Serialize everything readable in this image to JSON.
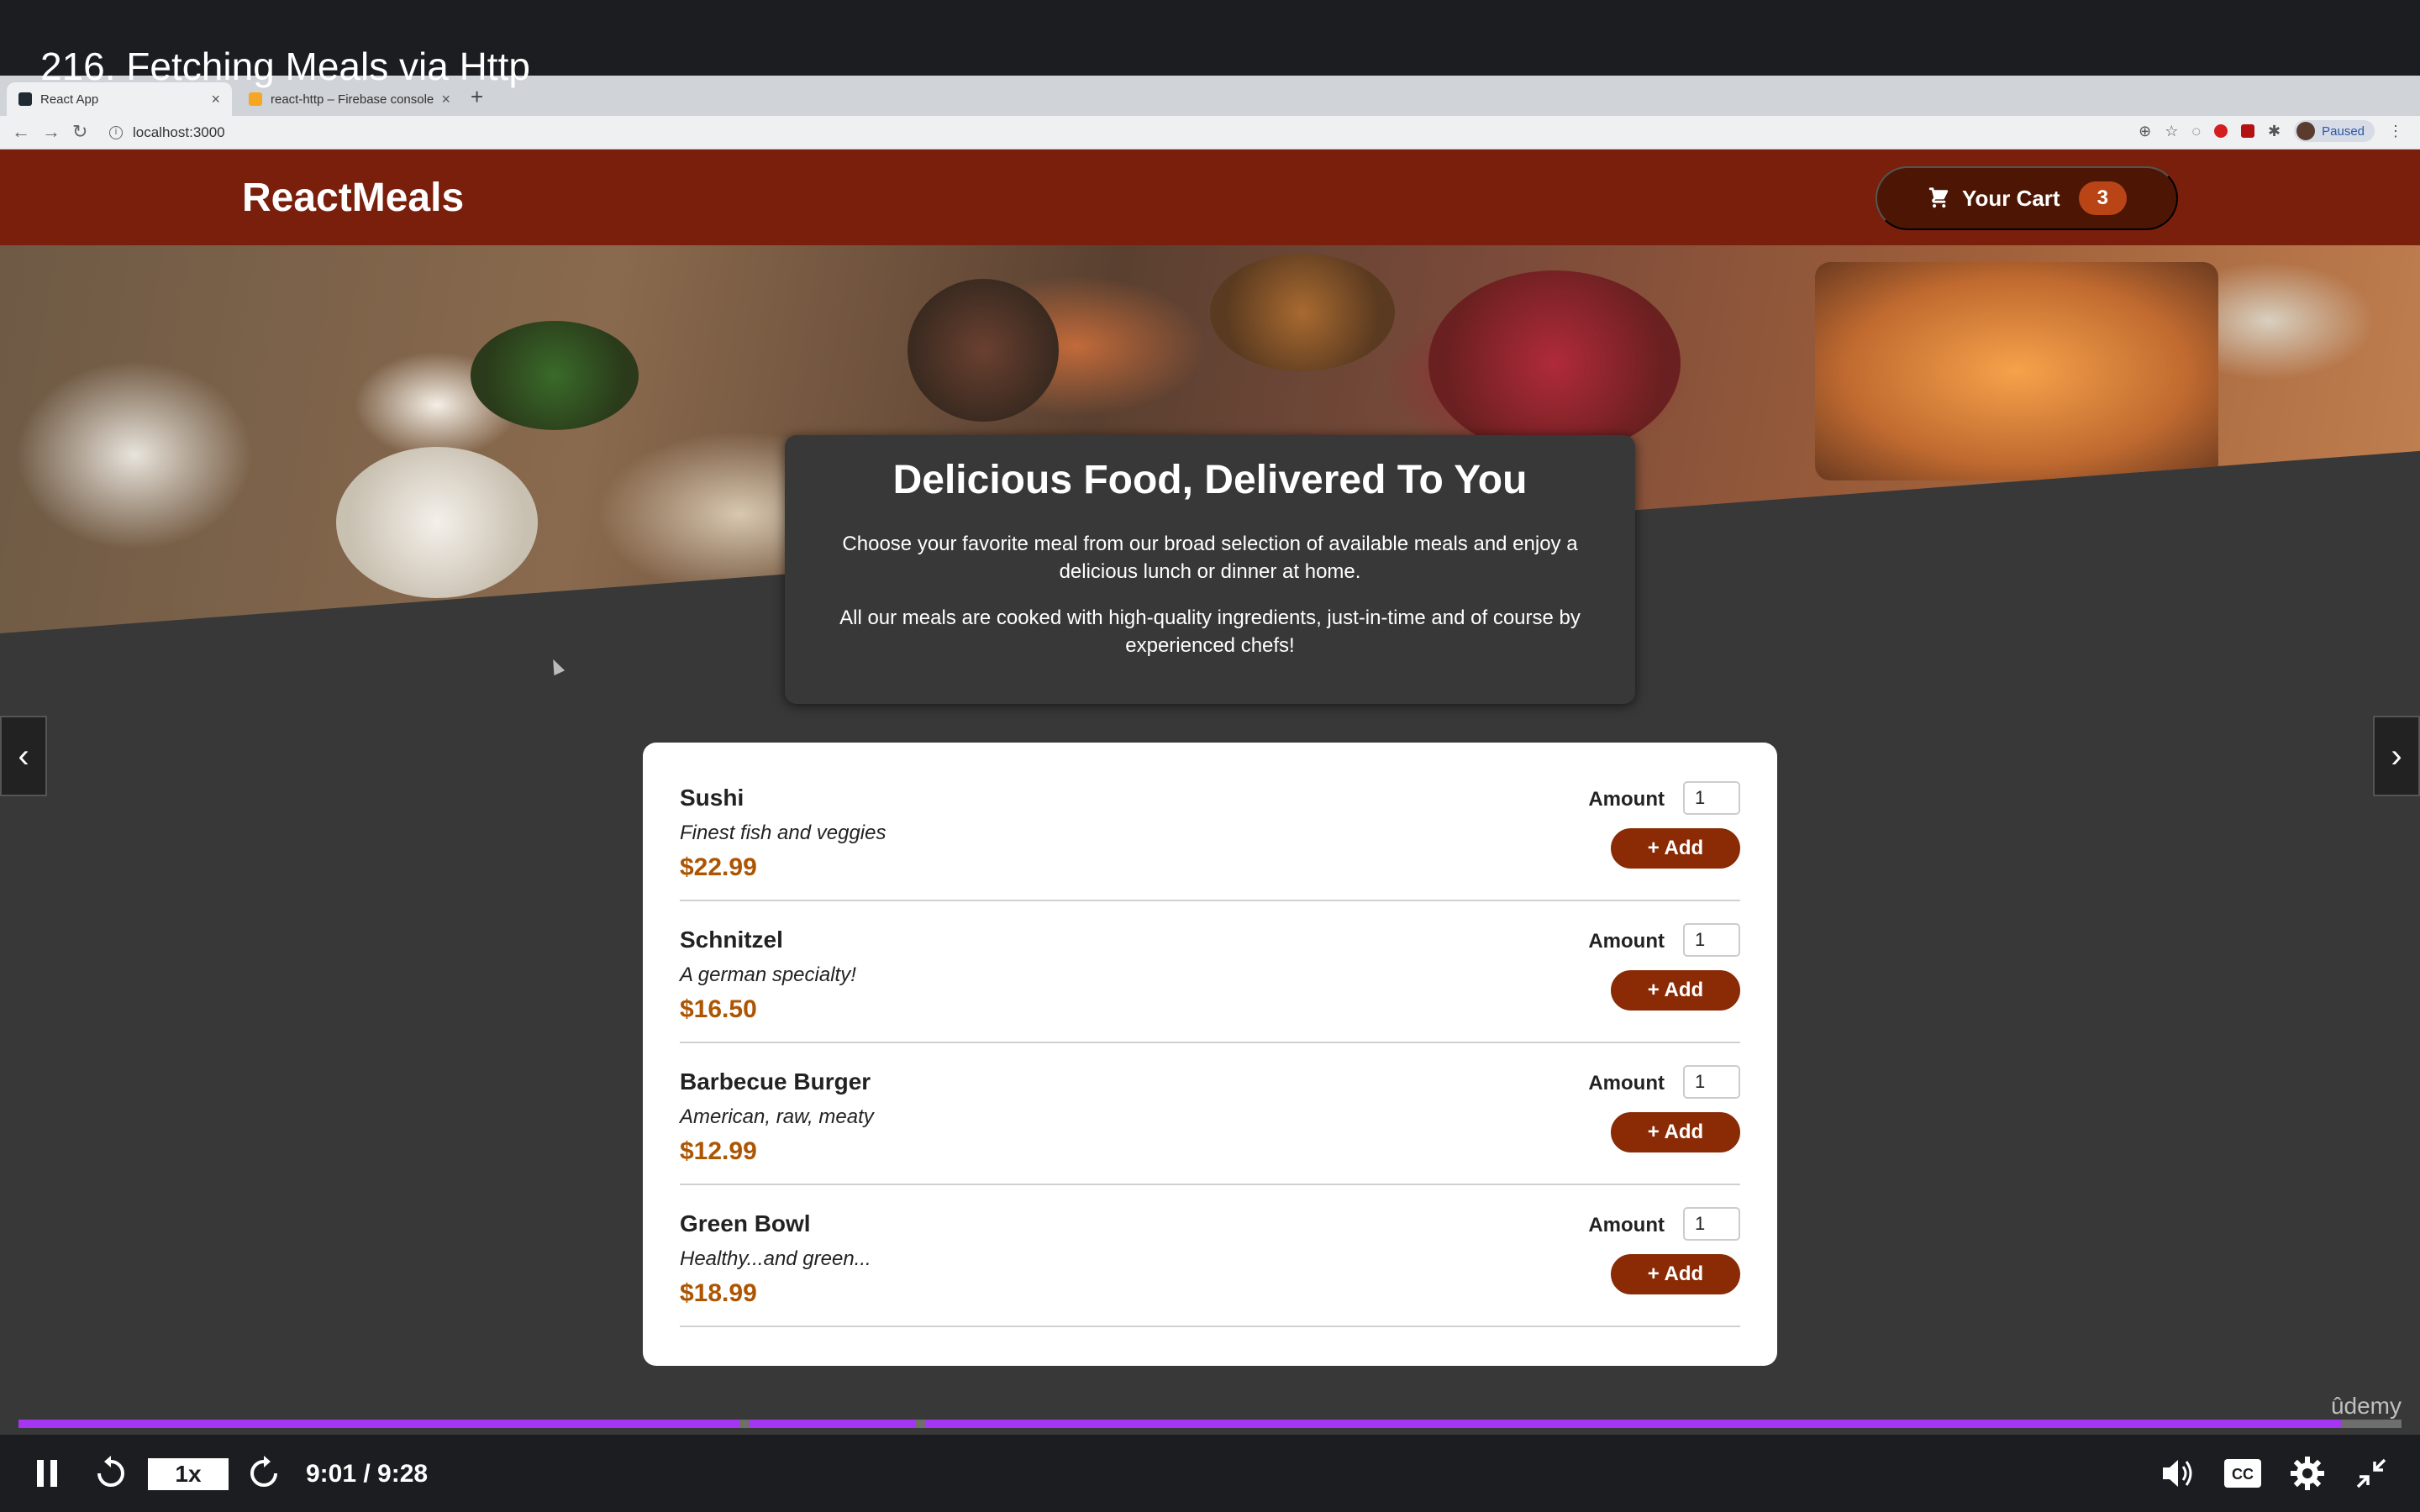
{
  "player": {
    "lecture_title": "216. Fetching Meals via Http",
    "rate": "1x",
    "time": "9:01 / 9:28",
    "progress": 0.975,
    "watermark": "ûdemy"
  },
  "browser": {
    "tabs": [
      {
        "label": "React App",
        "active": true
      },
      {
        "label": "react-http – Firebase console",
        "active": false
      }
    ],
    "url": "localhost:3000",
    "profile_label": "Paused"
  },
  "app": {
    "logo": "ReactMeals",
    "cart": {
      "label": "Your Cart",
      "count": "3"
    },
    "summary": {
      "title": "Delicious Food, Delivered To You",
      "p1": "Choose your favorite meal from our broad selection of available meals and enjoy a delicious lunch or dinner at home.",
      "p2": "All our meals are cooked with high-quality ingredients, just-in-time and of course by experienced chefs!"
    },
    "amount_label": "Amount",
    "add_label": "+ Add",
    "meals": [
      {
        "name": "Sushi",
        "description": "Finest fish and veggies",
        "price": "$22.99",
        "amount": "1"
      },
      {
        "name": "Schnitzel",
        "description": "A german specialty!",
        "price": "$16.50",
        "amount": "1"
      },
      {
        "name": "Barbecue Burger",
        "description": "American, raw, meaty",
        "price": "$12.99",
        "amount": "1"
      },
      {
        "name": "Green Bowl",
        "description": "Healthy...and green...",
        "price": "$18.99",
        "amount": "1"
      }
    ]
  },
  "colors": {
    "header": "#7a1f0c",
    "cart_button": "#4d1604",
    "badge": "#b94517",
    "add_button": "#8a2b06",
    "price": "#ad5502",
    "progress": "#a435f0"
  }
}
